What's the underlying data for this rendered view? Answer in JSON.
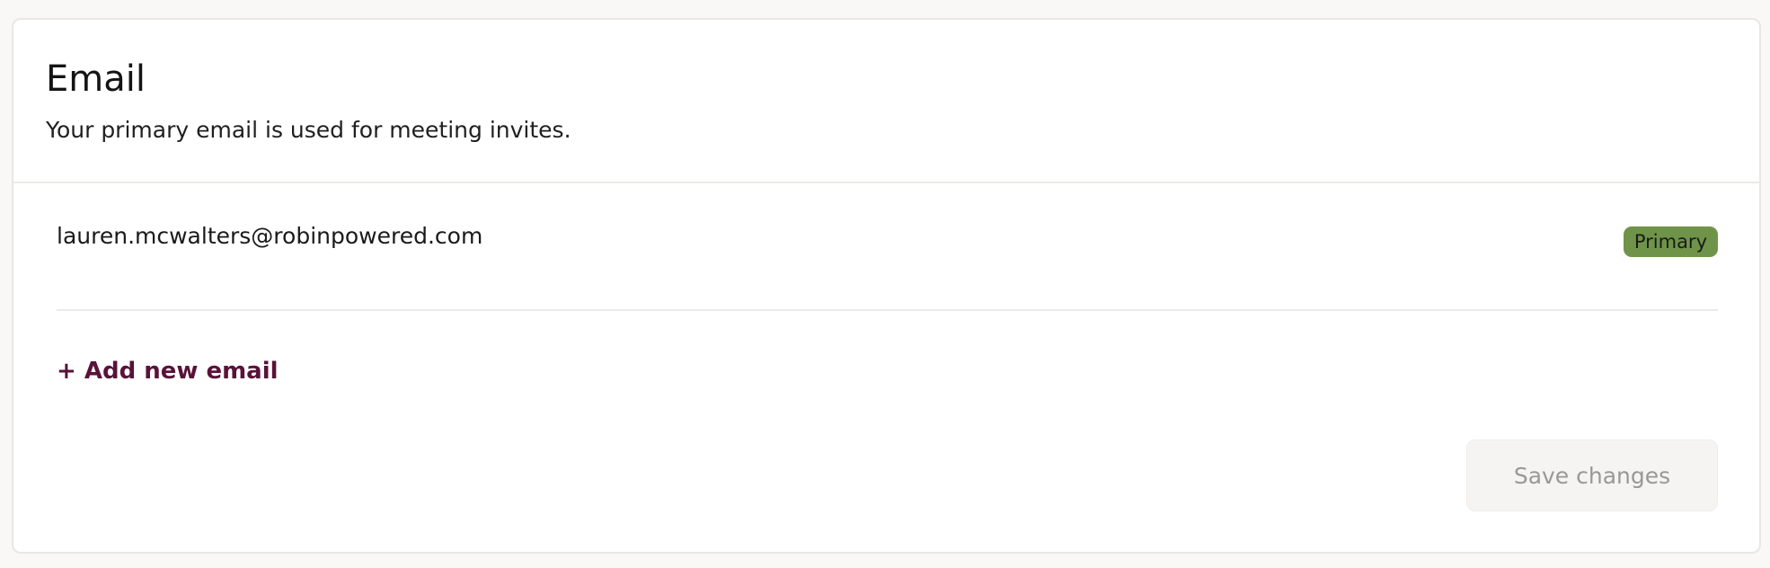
{
  "section": {
    "title": "Email",
    "subtitle": "Your primary email is used for meeting invites."
  },
  "emails": [
    {
      "address": "lauren.mcwalters@robinpowered.com",
      "badge": "Primary"
    }
  ],
  "actions": {
    "add_email_label": "+ Add new email",
    "save_label": "Save changes",
    "save_disabled": true
  },
  "colors": {
    "primary_badge": "#6f9449",
    "add_link": "#5a1239",
    "save_disabled_bg": "#f5f4f3",
    "save_disabled_text": "#9a9896"
  }
}
